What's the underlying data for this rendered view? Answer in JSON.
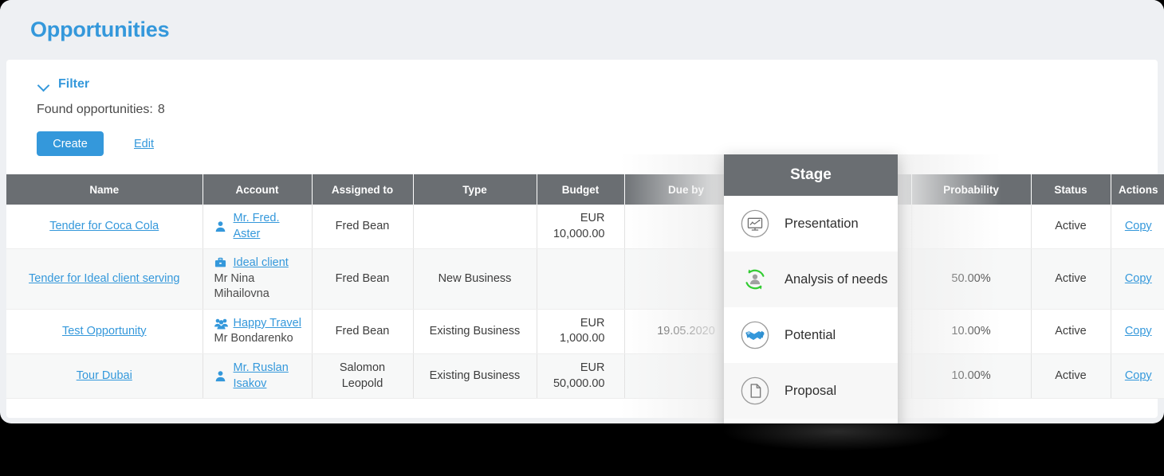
{
  "page": {
    "title": "Opportunities"
  },
  "filter": {
    "label": "Filter",
    "chevron_icon": "chevron-down-icon",
    "found_label": "Found opportunities:",
    "found_count": "8"
  },
  "toolbar": {
    "create_label": "Create",
    "edit_label": "Edit"
  },
  "table": {
    "columns": [
      {
        "key": "name",
        "label": "Name"
      },
      {
        "key": "account",
        "label": "Account"
      },
      {
        "key": "assigned",
        "label": "Assigned to"
      },
      {
        "key": "type",
        "label": "Type"
      },
      {
        "key": "budget",
        "label": "Budget"
      },
      {
        "key": "due",
        "label": "Due by"
      },
      {
        "key": "stage",
        "label": "Stage"
      },
      {
        "key": "prob",
        "label": "Probability"
      },
      {
        "key": "status",
        "label": "Status"
      },
      {
        "key": "actions",
        "label": "Actions"
      }
    ],
    "rows": [
      {
        "name": "Tender for Coca Cola",
        "account_icon": "person-icon",
        "account": "Mr. Fred. Aster",
        "account_sub": "",
        "assigned": "Fred Bean",
        "type": "",
        "budget": "EUR 10,000.00",
        "due": "",
        "stage": "",
        "prob": "",
        "status": "Active",
        "action": "Copy"
      },
      {
        "name": "Tender for Ideal client serving",
        "account_icon": "briefcase-icon",
        "account": "Ideal client",
        "account_sub": "Mr Nina Mihailovna",
        "assigned": "Fred Bean",
        "type": "New Business",
        "budget": "",
        "due": "",
        "stage": "",
        "prob": "50.00%",
        "status": "Active",
        "action": "Copy"
      },
      {
        "name": "Test Opportunity",
        "account_icon": "people-icon",
        "account": "Happy Travel",
        "account_sub": "Mr Bondarenko",
        "assigned": "Fred Bean",
        "type": "Existing Business",
        "budget": "EUR 1,000.00",
        "due": "19.05.2020",
        "stage": "",
        "prob": "10.00%",
        "status": "Active",
        "action": "Copy"
      },
      {
        "name": "Tour Dubai",
        "account_icon": "person-icon",
        "account": "Mr. Ruslan Isakov",
        "account_sub": "",
        "assigned": "Salomon Leopold",
        "type": "Existing Business",
        "budget": "EUR 50,000.00",
        "due": "",
        "stage": "",
        "prob": "10.00%",
        "status": "Active",
        "action": "Copy"
      }
    ]
  },
  "stage_popup": {
    "title": "Stage",
    "items": [
      {
        "label": "Presentation",
        "icon": "presentation-monitor-icon"
      },
      {
        "label": "Analysis of needs",
        "icon": "person-refresh-icon"
      },
      {
        "label": "Potential",
        "icon": "handshake-icon"
      },
      {
        "label": "Proposal",
        "icon": "document-icon"
      }
    ]
  },
  "colors": {
    "accent": "#3498db",
    "header_bg": "#6a6e72",
    "page_bg": "#eef0f3",
    "green": "#33cc33",
    "gray_icon": "#9b9b9b"
  }
}
